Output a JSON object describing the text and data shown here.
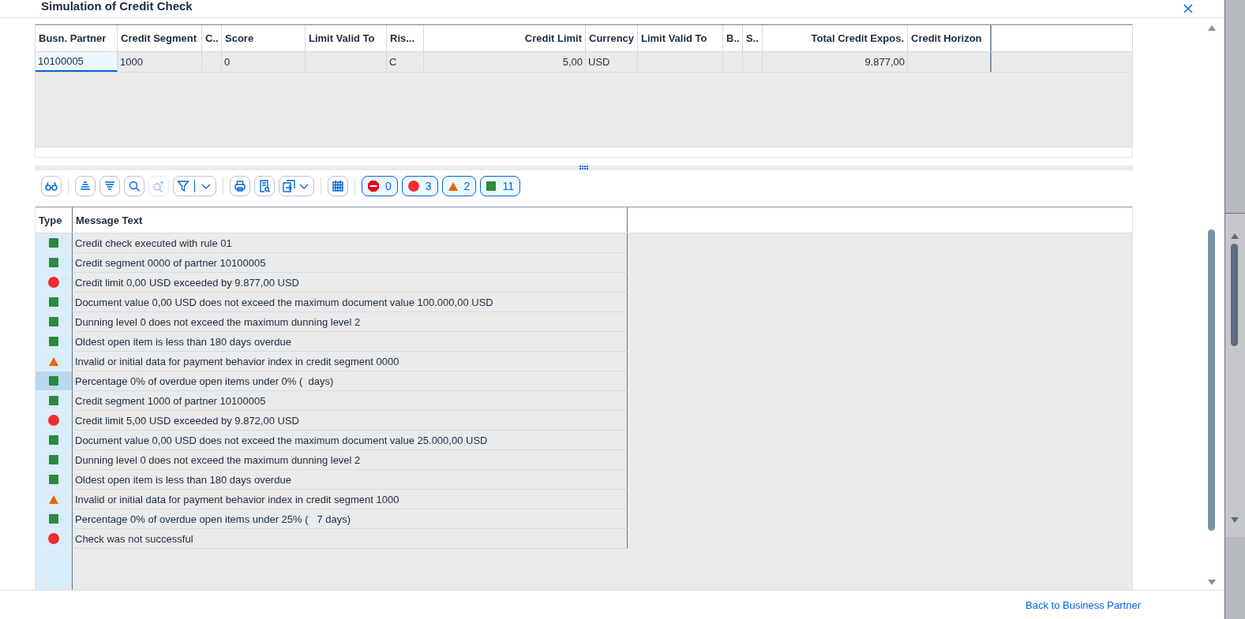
{
  "dialog": {
    "title": "Simulation of Credit Check"
  },
  "overview_table": {
    "columns": [
      "Busn. Partner",
      "Credit Segment",
      "C..",
      "Score",
      "Limit Valid To",
      "Ris...",
      "Credit Limit",
      "Currency",
      "Limit Valid To",
      "B..",
      "S..",
      "Total Credit Expos.",
      "Credit Horizon"
    ],
    "rows": [
      {
        "cells": [
          {
            "text": "10100005",
            "selected": true
          },
          {
            "text": "1000",
            "selected": false
          },
          {
            "text": "",
            "selected": false
          },
          {
            "text": "0",
            "selected": false
          },
          {
            "text": "",
            "selected": false
          },
          {
            "text": "C",
            "selected": false
          },
          {
            "text": "5,00",
            "selected": false
          },
          {
            "text": "USD",
            "selected": false
          },
          {
            "text": "",
            "selected": false
          },
          {
            "text": "",
            "selected": false
          },
          {
            "text": "",
            "selected": false
          },
          {
            "text": "9.877,00",
            "selected": false
          },
          {
            "text": "",
            "selected": false
          }
        ]
      }
    ]
  },
  "toolbar": {
    "buttons": [
      {
        "kind": "details",
        "disabled": false
      },
      {
        "kind": "sep"
      },
      {
        "kind": "sort-asc",
        "disabled": false
      },
      {
        "kind": "sort-desc",
        "disabled": false
      },
      {
        "kind": "find",
        "disabled": false
      },
      {
        "kind": "find-next",
        "disabled": true
      },
      {
        "kind": "filter",
        "disabled": false
      },
      {
        "kind": "sep"
      },
      {
        "kind": "print",
        "disabled": false
      },
      {
        "kind": "preview",
        "disabled": false
      },
      {
        "kind": "export",
        "disabled": false
      },
      {
        "kind": "sep"
      },
      {
        "kind": "layout",
        "disabled": false
      },
      {
        "kind": "sep"
      }
    ],
    "counters": [
      {
        "kind": "stop",
        "count": "0"
      },
      {
        "kind": "error",
        "count": "3"
      },
      {
        "kind": "warning",
        "count": "2"
      },
      {
        "kind": "success",
        "count": "11"
      }
    ]
  },
  "messages_table": {
    "columns": [
      "Type",
      "Message Text"
    ],
    "rows": [
      {
        "kind": "success",
        "text": "Credit check executed with rule 01",
        "selected": false
      },
      {
        "kind": "success",
        "text": "Credit segment 0000 of partner 10100005",
        "selected": false
      },
      {
        "kind": "error",
        "text": "Credit limit 0,00 USD exceeded by 9.877,00 USD",
        "selected": false
      },
      {
        "kind": "success",
        "text": "Document value 0,00 USD does not exceed the maximum document value 100.000,00 USD",
        "selected": false
      },
      {
        "kind": "success",
        "text": "Dunning level 0 does not exceed the maximum dunning level 2",
        "selected": false
      },
      {
        "kind": "success",
        "text": "Oldest open item is less than 180 days overdue",
        "selected": false
      },
      {
        "kind": "warning",
        "text": "Invalid or initial data for payment behavior index in credit segment 0000",
        "selected": false
      },
      {
        "kind": "success",
        "text": "Percentage 0% of overdue open items under 0% (  days)",
        "selected": true
      },
      {
        "kind": "success",
        "text": "Credit segment 1000 of partner 10100005",
        "selected": false
      },
      {
        "kind": "error",
        "text": "Credit limit 5,00 USD exceeded by 9.872,00 USD",
        "selected": false
      },
      {
        "kind": "success",
        "text": "Document value 0,00 USD does not exceed the maximum document value 25.000,00 USD",
        "selected": false
      },
      {
        "kind": "success",
        "text": "Dunning level 0 does not exceed the maximum dunning level 2",
        "selected": false
      },
      {
        "kind": "success",
        "text": "Oldest open item is less than 180 days overdue",
        "selected": false
      },
      {
        "kind": "warning",
        "text": "Invalid or initial data for payment behavior index in credit segment 1000",
        "selected": false
      },
      {
        "kind": "success",
        "text": "Percentage 0% of overdue open items under 25% (   7 days)",
        "selected": false
      },
      {
        "kind": "error",
        "text": "Check was not successful",
        "selected": false
      }
    ]
  },
  "footer": {
    "link": "Back to Business Partner"
  }
}
